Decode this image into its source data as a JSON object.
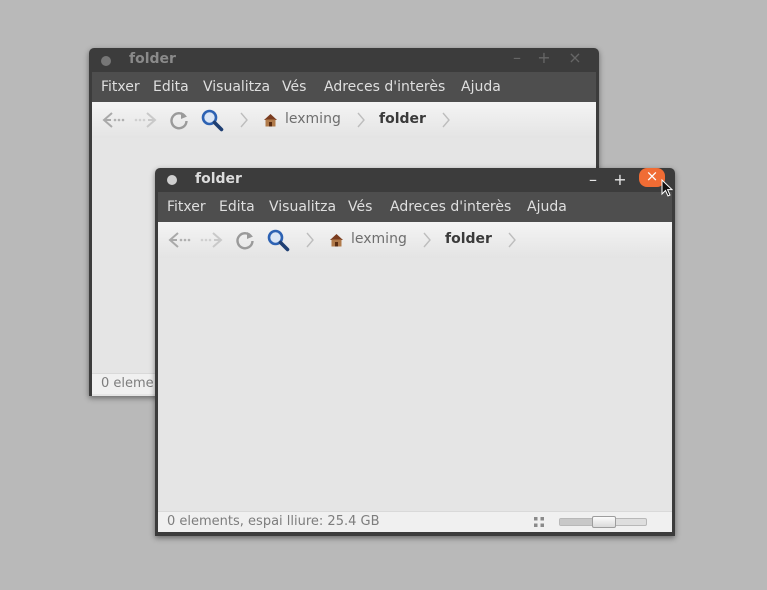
{
  "back_window": {
    "title": "folder",
    "controls": {
      "minimize": "–",
      "maximize": "+",
      "close": "×"
    },
    "menu": [
      "Fitxer",
      "Edita",
      "Visualitza",
      "Vés",
      "Adreces d'interès",
      "Ajuda"
    ],
    "breadcrumb": {
      "home": "lexming",
      "current": "folder"
    },
    "status": "0 eleme"
  },
  "front_window": {
    "title": "folder",
    "controls": {
      "minimize": "–",
      "maximize": "+",
      "close": "×"
    },
    "menu": [
      "Fitxer",
      "Edita",
      "Visualitza",
      "Vés",
      "Adreces d'interès",
      "Ajuda"
    ],
    "breadcrumb": {
      "home": "lexming",
      "current": "folder"
    },
    "status": "0 elements, espai lliure: 25.4 GB",
    "zoom_level": 0.5
  },
  "icons": [
    "back-arrow-icon",
    "forward-arrow-icon",
    "reload-icon",
    "search-icon",
    "home-folder-icon",
    "grid-view-icon",
    "mouse-cursor-icon"
  ],
  "colors": {
    "close_button": "#f06c34",
    "titlebar": "#3c3c3c",
    "menubar": "#4e4e4e",
    "content": "#e5e5e5"
  }
}
